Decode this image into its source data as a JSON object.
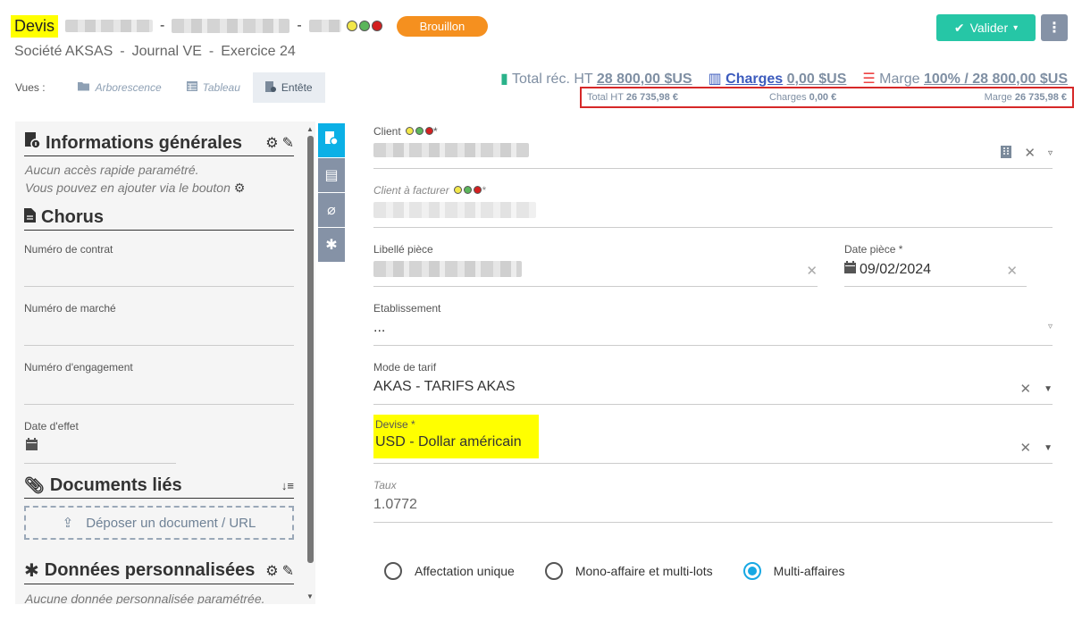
{
  "header": {
    "doc_type": "Devis",
    "badge": "Brouillon",
    "societe": "Société AKSAS",
    "journal": "Journal VE",
    "exercice": "Exercice 24",
    "valider_label": "Valider",
    "caret": "▾",
    "more_icon": "⋮"
  },
  "views": {
    "label": "Vues :",
    "tabs": [
      {
        "label": "Arborescence",
        "icon": "folder-icon"
      },
      {
        "label": "Tableau",
        "icon": "table-icon"
      },
      {
        "label": "Entête",
        "icon": "header-icon"
      }
    ]
  },
  "totals": {
    "total_label": "Total réc. HT",
    "total_value": "28 800,00 $US",
    "charges_label": "Charges",
    "charges_value": "0,00 $US",
    "marge_label": "Marge",
    "marge_value": "100% / 28 800,00 $US"
  },
  "totals_eur": {
    "total_label": "Total HT",
    "total_value": "26 735,98 €",
    "charges_label": "Charges",
    "charges_value": "0,00 €",
    "marge_label": "Marge",
    "marge_value": "26 735,98 €"
  },
  "left_panel": {
    "info_title": "Informations générales",
    "hint1": "Aucun accès rapide paramétré.",
    "hint2": "Vous pouvez en ajouter via le bouton",
    "chorus_title": "Chorus",
    "fields": [
      "Numéro de contrat",
      "Numéro de marché",
      "Numéro d'engagement",
      "Date d'effet"
    ],
    "docs_title": "Documents liés",
    "upload_label": "Déposer un document / URL",
    "perso_title": "Données personnalisées",
    "perso_hint": "Aucune donnée personnalisée paramétrée."
  },
  "form": {
    "client_label": "Client",
    "client_facturer_label": "Client à facturer",
    "libelle_label": "Libellé pièce",
    "date_label": "Date pièce *",
    "date_value": "09/02/2024",
    "etablissement_label": "Etablissement",
    "etablissement_value": "...",
    "mode_tarif_label": "Mode de tarif",
    "mode_tarif_value": "AKAS - TARIFS AKAS",
    "devise_label": "Devise *",
    "devise_value": "USD - Dollar américain",
    "taux_label": "Taux",
    "taux_value": "1.0772",
    "required_mark": "*",
    "clear": "✕",
    "caret_down": "▼",
    "caret_outline": "▿"
  },
  "affectation": {
    "options": [
      "Affectation unique",
      "Mono-affaire et multi-lots",
      "Multi-affaires"
    ],
    "selected": "Multi-affaires"
  },
  "colors": {
    "accent": "#26c6a6",
    "brand_blue": "#0bb0e6",
    "badge": "#f5901f",
    "highlight": "#ffff00"
  }
}
